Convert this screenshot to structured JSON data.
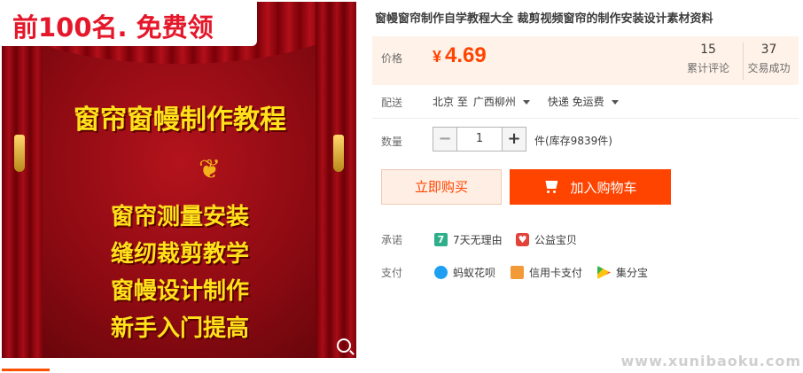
{
  "product": {
    "title": "窗幔窗帘制作自学教程大全 裁剪视频窗帘的制作安装设计素材资料",
    "image": {
      "promo_text": "前100名. 免费领",
      "poster_title": "窗帘窗幔制作教程",
      "poster_lines": [
        "窗帘测量安装",
        "缝纫裁剪教学",
        "窗幔设计制作",
        "新手入门提高"
      ]
    }
  },
  "price": {
    "label": "价格",
    "currency": "¥",
    "value": "4.69",
    "reviews_count": "15",
    "reviews_label": "累计评论",
    "deals_count": "37",
    "deals_label": "交易成功"
  },
  "shipping": {
    "label": "配送",
    "origin": "北京 至",
    "destination": "广西柳州",
    "method": "快递 免运费"
  },
  "quantity": {
    "label": "数量",
    "value": "1",
    "minus": "−",
    "plus": "+",
    "stock_text": "件(库存9839件)"
  },
  "actions": {
    "buy_now": "立即购买",
    "add_to_cart": "加入购物车"
  },
  "promise": {
    "label": "承诺",
    "items": [
      {
        "icon": "seven-day-return-icon",
        "glyph": "7",
        "text": "7天无理由"
      },
      {
        "icon": "charity-icon",
        "glyph": "♥",
        "text": "公益宝贝"
      }
    ]
  },
  "payment": {
    "label": "支付",
    "items": [
      {
        "icon": "huabei-icon",
        "text": "蚂蚁花呗"
      },
      {
        "icon": "credit-card-icon",
        "text": "信用卡支付"
      },
      {
        "icon": "jifenbao-icon",
        "text": "集分宝"
      }
    ]
  },
  "watermark": "www.xunibaoku.com",
  "colors": {
    "accent": "#ff4400",
    "price_bg": "#fff2e8",
    "poster_red": "#a80d17",
    "poster_text": "#ffe21a"
  }
}
